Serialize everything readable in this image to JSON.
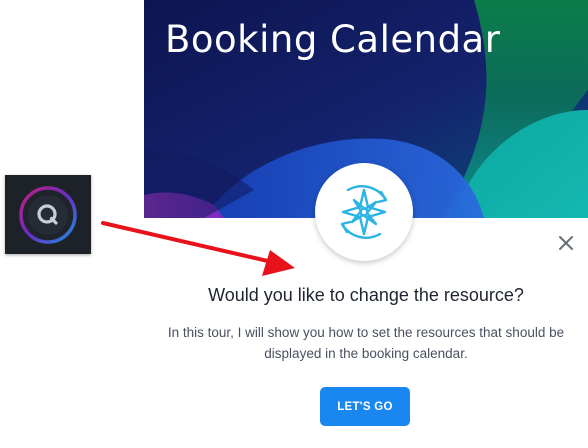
{
  "banner": {
    "title": "Booking Calendar"
  },
  "icons": {
    "badge": "compass-icon",
    "close": "close-icon",
    "logo": "q-logo-icon",
    "arrow": "pointer-arrow"
  },
  "tour": {
    "heading": "Would you like to change the resource?",
    "body": "In this tour, I will show you how to set the resources that should be displayed in the booking calendar.",
    "cta_label": "LET'S GO"
  },
  "colors": {
    "accent": "#1a86f0",
    "badge_icon": "#2bb3e3",
    "banner_dark": "#0f1a55",
    "arrow": "#e8121b"
  }
}
